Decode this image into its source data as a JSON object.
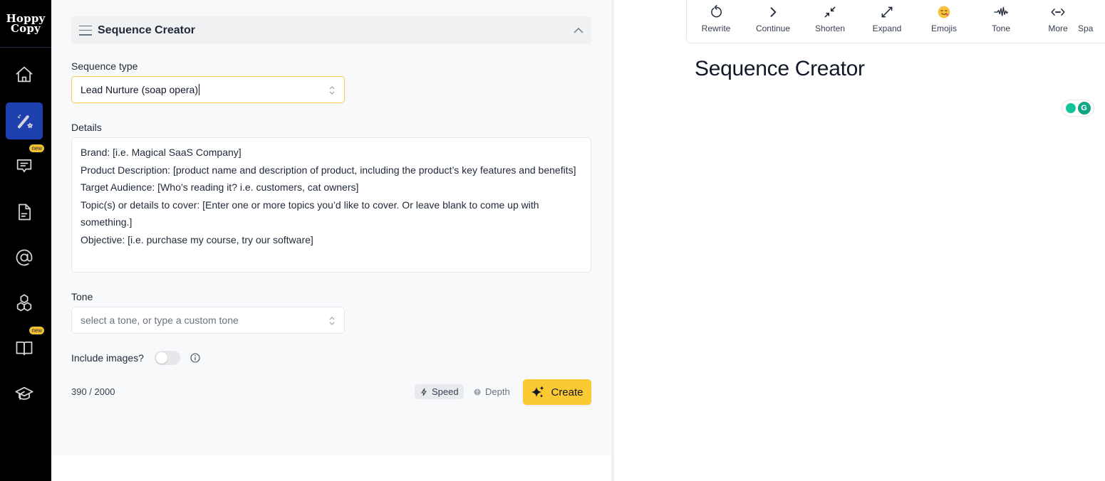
{
  "sidebar": {
    "logo_line1": "Hoppy",
    "logo_line2": "Copy",
    "items": [
      {
        "name": "home",
        "icon": "home-icon",
        "active": false
      },
      {
        "name": "magic-wand",
        "icon": "magic-wand-icon",
        "active": true
      },
      {
        "name": "chat",
        "icon": "chat-icon",
        "active": false,
        "badge": "new"
      },
      {
        "name": "documents",
        "icon": "document-icon",
        "active": false
      },
      {
        "name": "email",
        "icon": "at-sign-icon",
        "active": false
      },
      {
        "name": "templates",
        "icon": "cubes-icon",
        "active": false
      },
      {
        "name": "library",
        "icon": "book-icon",
        "active": false,
        "badge": "new"
      },
      {
        "name": "learn",
        "icon": "graduation-cap-icon",
        "active": false
      }
    ]
  },
  "form": {
    "header_title": "Sequence Creator",
    "sequence_type_label": "Sequence type",
    "sequence_type_value": "Lead Nurture (soap opera)",
    "details_label": "Details",
    "details_lines": [
      "Brand: [i.e. Magical SaaS Company]",
      "Product Description: [product name and description of product, including the product’s key features and benefits]",
      "Target Audience: [Who’s reading it? i.e. customers, cat owners]",
      "Topic(s) or details to cover: [Enter one or more topics you’d like to cover. Or leave blank to come up with something.]",
      "Objective: [i.e. purchase my course, try our software]"
    ],
    "tone_label": "Tone",
    "tone_placeholder": "select a tone, or type a custom tone",
    "include_images_label": "Include images?",
    "include_images_on": false,
    "char_count": "390 / 2000",
    "mode_speed": "Speed",
    "mode_depth": "Depth",
    "selected_mode": "Speed",
    "create_label": "Create"
  },
  "editor": {
    "toolbar": [
      {
        "label": "Rewrite",
        "icon": "rewrite-icon"
      },
      {
        "label": "Continue",
        "icon": "chevron-right-icon"
      },
      {
        "label": "Shorten",
        "icon": "shorten-icon"
      },
      {
        "label": "Expand",
        "icon": "expand-icon"
      },
      {
        "label": "Emojis",
        "icon": "emoji-icon"
      },
      {
        "label": "Tone",
        "icon": "tone-wave-icon"
      },
      {
        "label": "More",
        "icon": "more-code-icon"
      },
      {
        "label": "Spa",
        "icon": ""
      }
    ],
    "title": "Sequence Creator"
  },
  "colors": {
    "accent_yellow": "#fbc932",
    "sidebar_active": "#1e3fae",
    "sidebar_bg": "#000000",
    "badge": "#f6c12f"
  }
}
